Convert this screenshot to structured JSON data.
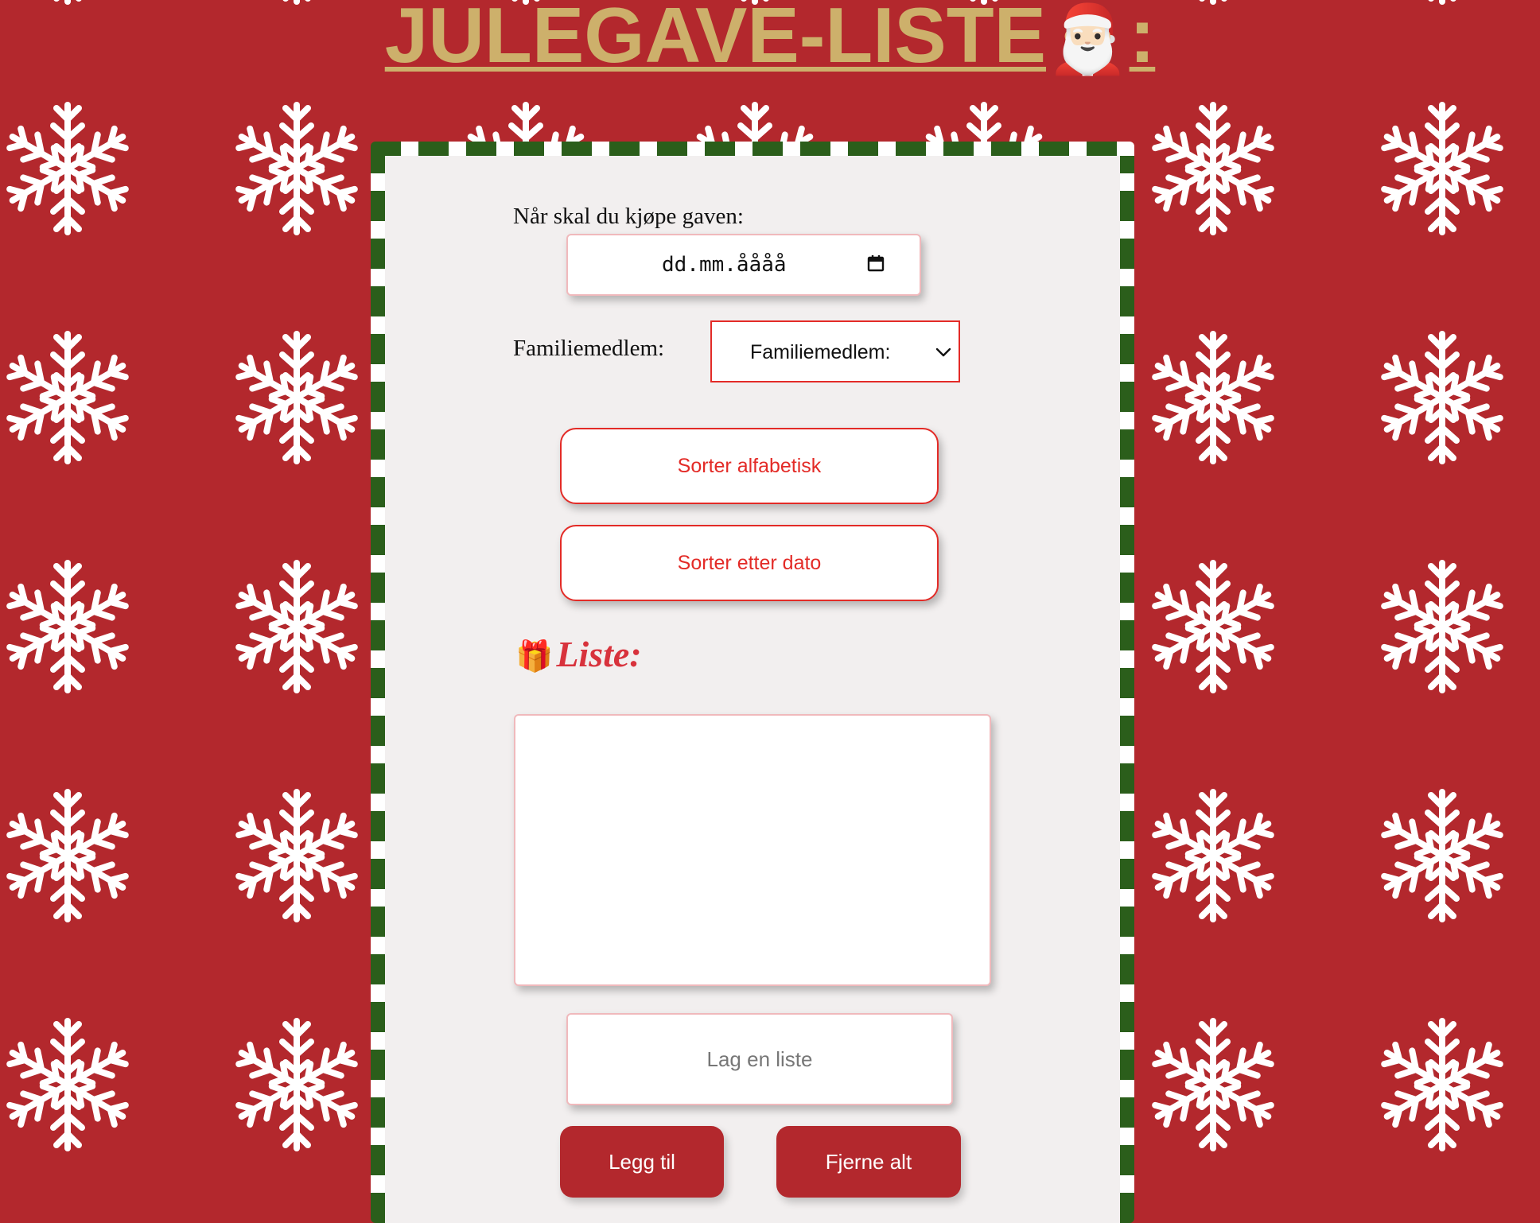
{
  "page": {
    "title_text": "JULEGAVE-LISTE",
    "title_emoji": "🎅🏻",
    "title_colon": ":"
  },
  "form": {
    "date_label": "Når skal du kjøpe gaven:",
    "date_placeholder": "dd.mm.åååå",
    "family_label": "Familiemedlem:",
    "family_select_value": "Familiemedlem:",
    "sort_alpha_label": "Sorter alfabetisk",
    "sort_date_label": "Sorter etter dato"
  },
  "list": {
    "heading_icon": "🎁",
    "heading": "Liste:",
    "items": []
  },
  "entry": {
    "placeholder": "Lag en liste",
    "add_label": "Legg til",
    "clear_label": "Fjerne alt"
  },
  "colors": {
    "background_red": "#b3282d",
    "title_gold": "#cdb06b",
    "card_bg": "#f2efef",
    "stripe_green": "#2b5e1b",
    "accent_red": "#e32b27"
  },
  "icons": {
    "background": "snowflake-icon",
    "date_picker": "calendar-icon",
    "select": "chevron-down-icon"
  }
}
